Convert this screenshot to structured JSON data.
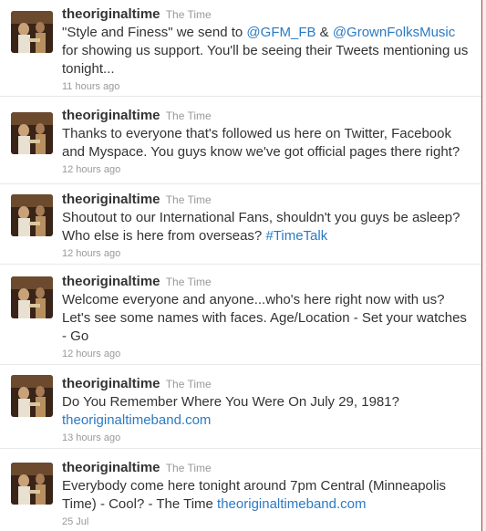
{
  "tweets": [
    {
      "screen_name": "theoriginaltime",
      "full_name": "The Time",
      "text_1": "\"Style and Finess\" we send to ",
      "mention_1": "@GFM_FB",
      "text_2": " & ",
      "mention_2": "@GrownFolksMusic",
      "text_3": " for showing us support. You'll be seeing their Tweets mentioning us tonight...",
      "time": "11 hours ago"
    },
    {
      "screen_name": "theoriginaltime",
      "full_name": "The Time",
      "text": "Thanks to everyone that's followed us here on Twitter, Facebook and Myspace. You guys know we've got official pages there right?",
      "time": "12 hours ago"
    },
    {
      "screen_name": "theoriginaltime",
      "full_name": "The Time",
      "text": "Shoutout to our International Fans, shouldn't you guys be asleep? Who else is here from overseas? ",
      "hashtag": "#TimeTalk",
      "time": "12 hours ago"
    },
    {
      "screen_name": "theoriginaltime",
      "full_name": "The Time",
      "text": "Welcome everyone and anyone...who's here right now with us? Let's see some names with faces. Age/Location - Set your watches - Go",
      "time": "12 hours ago"
    },
    {
      "screen_name": "theoriginaltime",
      "full_name": "The Time",
      "text": "Do You Remember Where You Were On July 29, 1981?",
      "link": "theoriginaltimeband.com",
      "time": "13 hours ago"
    },
    {
      "screen_name": "theoriginaltime",
      "full_name": "The Time",
      "text": "Everybody come here tonight around 7pm Central (Minneapolis Time) - Cool? - The Time ",
      "link": "theoriginaltimeband.com",
      "time": "25 Jul"
    }
  ],
  "colors": {
    "link": "#2a7ac4",
    "text": "#333333",
    "meta": "#999999",
    "right_border": "#c0392b"
  }
}
